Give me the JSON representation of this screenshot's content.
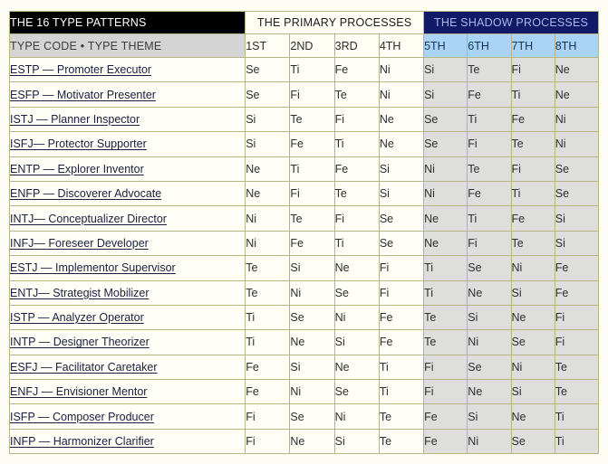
{
  "table": {
    "header": {
      "title": "THE 16 TYPE PATTERNS",
      "primary_group": "THE PRIMARY PROCESSES",
      "shadow_group": "THE SHADOW PROCESSES"
    },
    "subheader": {
      "type_theme": "TYPE CODE • TYPE THEME",
      "primary_cols": [
        "1ST",
        "2ND",
        "3RD",
        "4TH"
      ],
      "shadow_cols": [
        "5TH",
        "6TH",
        "7TH",
        "8TH"
      ]
    },
    "colors": {
      "title_bg": "#000000",
      "title_fg": "#ffffff",
      "shadow_header_bg": "#101a66",
      "shadow_header_fg": "#a9b8ea",
      "subheader_bg": "#d4d4d4",
      "shadow_sub_bg": "#a9d4f5",
      "shadow_cell_bg": "#dededc",
      "primary_cell_bg": "#fffff8",
      "border": "#b5b585",
      "link_fg": "#1a1f3d",
      "page_bg": "#fdfdf5"
    },
    "rows": [
      {
        "type": "ESTP — Promoter Executor",
        "primary": [
          "Se",
          "Ti",
          "Fe",
          "Ni"
        ],
        "shadow": [
          "Si",
          "Te",
          "Fi",
          "Ne"
        ]
      },
      {
        "type": "ESFP — Motivator Presenter",
        "primary": [
          "Se",
          "Fi",
          "Te",
          "Ni"
        ],
        "shadow": [
          "Si",
          "Fe",
          "Ti",
          "Ne"
        ]
      },
      {
        "type": "ISTJ — Planner Inspector",
        "primary": [
          "Si",
          "Te",
          "Fi",
          "Ne"
        ],
        "shadow": [
          "Se",
          "Ti",
          "Fe",
          "Ni"
        ]
      },
      {
        "type": "ISFJ— Protector Supporter",
        "primary": [
          "Si",
          "Fe",
          "Ti",
          "Ne"
        ],
        "shadow": [
          "Se",
          "Fi",
          "Te",
          "Ni"
        ]
      },
      {
        "type": "ENTP — Explorer Inventor",
        "primary": [
          "Ne",
          "Ti",
          "Fe",
          "Si"
        ],
        "shadow": [
          "Ni",
          "Te",
          "Fi",
          "Se"
        ]
      },
      {
        "type": "ENFP — Discoverer Advocate",
        "primary": [
          "Ne",
          "Fi",
          "Te",
          "Si"
        ],
        "shadow": [
          "Ni",
          "Fe",
          "Ti",
          "Se"
        ]
      },
      {
        "type": "INTJ— Conceptualizer Director",
        "primary": [
          "Ni",
          "Te",
          "Fi",
          "Se"
        ],
        "shadow": [
          "Ne",
          "Ti",
          "Fe",
          "Si"
        ]
      },
      {
        "type": "INFJ— Foreseer Developer",
        "primary": [
          "Ni",
          "Fe",
          "Ti",
          "Se"
        ],
        "shadow": [
          "Ne",
          "Fi",
          "Te",
          "Si"
        ]
      },
      {
        "type": "ESTJ — Implementor Supervisor",
        "primary": [
          "Te",
          "Si",
          "Ne",
          "Fi"
        ],
        "shadow": [
          "Ti",
          "Se",
          "Ni",
          "Fe"
        ]
      },
      {
        "type": "ENTJ— Strategist Mobilizer",
        "primary": [
          "Te",
          "Ni",
          "Se",
          "Fi"
        ],
        "shadow": [
          "Ti",
          "Ne",
          "Si",
          "Fe"
        ]
      },
      {
        "type": "ISTP — Analyzer Operator",
        "primary": [
          "Ti",
          "Se",
          "Ni",
          "Fe"
        ],
        "shadow": [
          "Te",
          "Si",
          "Ne",
          "Fi"
        ]
      },
      {
        "type": "INTP — Designer Theorizer",
        "primary": [
          "Ti",
          "Ne",
          "Si",
          "Fe"
        ],
        "shadow": [
          "Te",
          "Ni",
          "Se",
          "Fi"
        ]
      },
      {
        "type": "ESFJ — Facilitator Caretaker",
        "primary": [
          "Fe",
          "Si",
          "Ne",
          "Ti"
        ],
        "shadow": [
          "Fi",
          "Se",
          "Ni",
          "Te"
        ]
      },
      {
        "type": "ENFJ — Envisioner Mentor",
        "primary": [
          "Fe",
          "Ni",
          "Se",
          "Ti"
        ],
        "shadow": [
          "Fi",
          "Ne",
          "Si",
          "Te"
        ]
      },
      {
        "type": "ISFP — Composer Producer",
        "primary": [
          "Fi",
          "Se",
          "Ni",
          "Te"
        ],
        "shadow": [
          "Fe",
          "Si",
          "Ne",
          "Ti"
        ]
      },
      {
        "type": "INFP — Harmonizer Clarifier",
        "primary": [
          "Fi",
          "Ne",
          "Si",
          "Te"
        ],
        "shadow": [
          "Fe",
          "Ni",
          "Se",
          "Ti"
        ]
      }
    ]
  }
}
